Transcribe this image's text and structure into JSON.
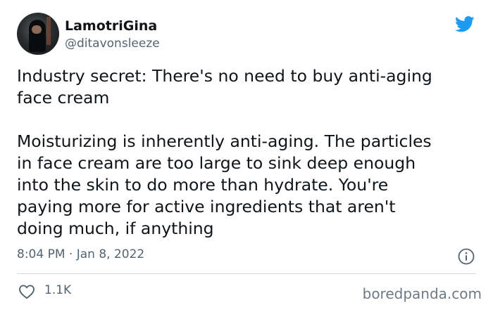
{
  "tweet": {
    "display_name": "LamotriGina",
    "handle": "@ditavonsleeze",
    "text": "Industry secret: There's no need to buy anti-aging\nface cream\n\nMoisturizing is inherently anti-aging. The particles\nin face cream are too large to sink deep enough\ninto the skin to do more than hydrate. You're\npaying more for active ingredients that aren't\ndoing much, if anything",
    "timestamp": "8:04 PM · Jan 8, 2022",
    "like_count": "1.1K"
  },
  "icons": {
    "brand": "twitter-bird-icon",
    "info": "info-icon",
    "like": "heart-icon"
  },
  "colors": {
    "twitter_blue": "#1d9bf0",
    "secondary_text": "#536471",
    "divider": "#cfd9de"
  },
  "watermark": "boredpanda.com"
}
